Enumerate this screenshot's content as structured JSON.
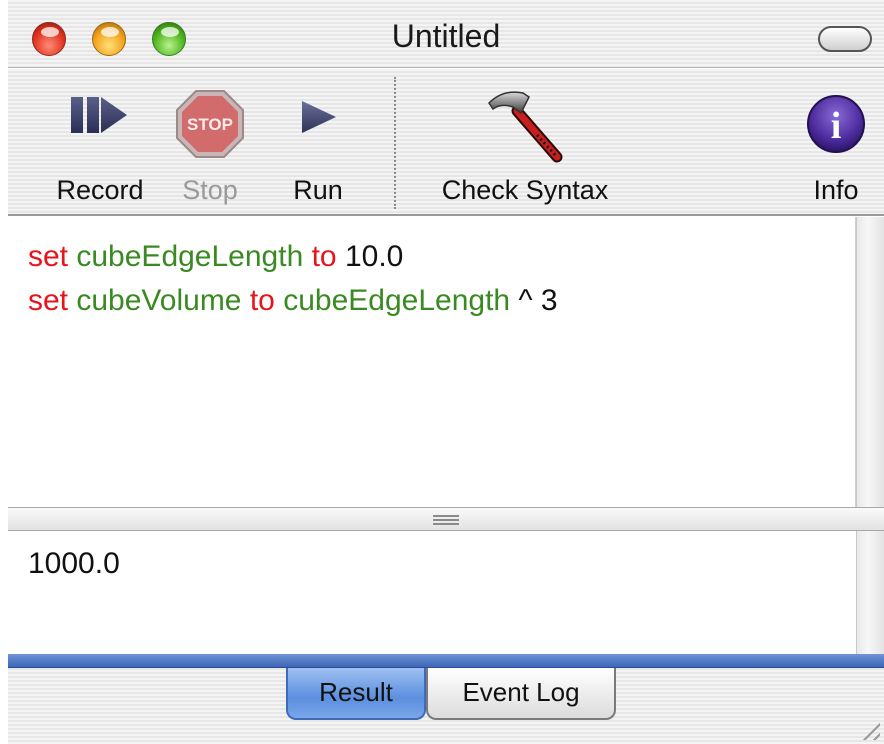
{
  "window": {
    "title": "Untitled"
  },
  "toolbar": {
    "record_label": "Record",
    "stop_label": "Stop",
    "stop_icon_text": "STOP",
    "run_label": "Run",
    "check_syntax_label": "Check Syntax",
    "info_label": "Info",
    "info_icon_text": "i"
  },
  "script": {
    "line1": {
      "kw1": "set",
      "var1": "cubeEdgeLength",
      "kw2": "to",
      "val": "10.0"
    },
    "line2": {
      "kw1": "set",
      "var1": "cubeVolume",
      "kw2": "to",
      "var2": "cubeEdgeLength",
      "op": "^ 3"
    }
  },
  "result": {
    "value": "1000.0"
  },
  "tabs": [
    {
      "label": "Result",
      "selected": true
    },
    {
      "label": "Event Log",
      "selected": false
    }
  ],
  "colors": {
    "keyword": "#e8141c",
    "variable": "#3a8a22",
    "selected_tab": "#5b8fde"
  }
}
